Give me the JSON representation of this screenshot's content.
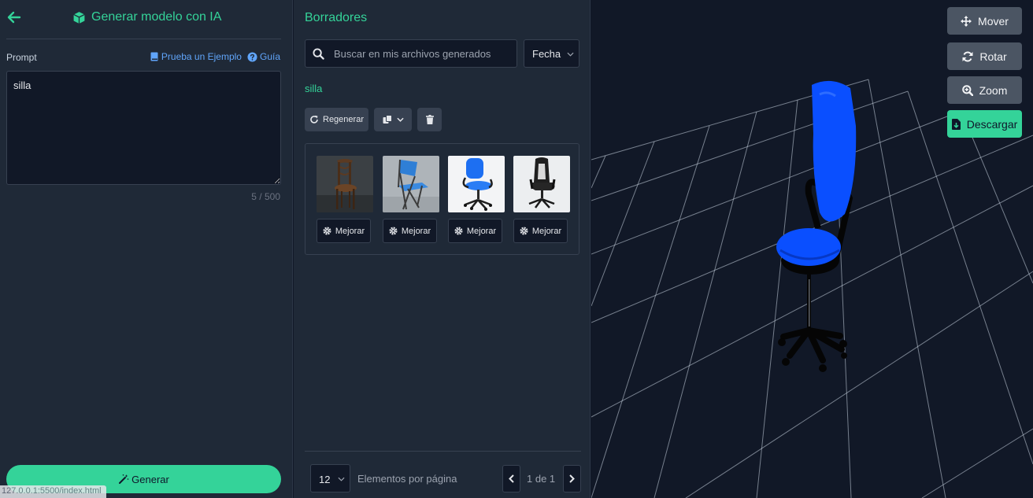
{
  "colors": {
    "accent": "#34d399",
    "link": "#60a5fa",
    "panel": "#1f2937",
    "background": "#111827",
    "model": "#0a4fff"
  },
  "left_panel": {
    "back_icon": "arrow-left-icon",
    "title_icon": "cube-icon",
    "title": "Generar modelo con IA",
    "prompt_label": "Prompt",
    "example_link": "Prueba un Ejemplo",
    "example_icon": "book-icon",
    "guide_link": "Guía",
    "guide_icon": "question-circle-icon",
    "prompt_value": "silla",
    "char_count": "5 / 500",
    "generate_label": "Generar",
    "generate_icon": "magic-wand-icon",
    "status_url": "127.0.0.1:5500/index.html"
  },
  "middle_panel": {
    "title": "Borradores",
    "search_placeholder": "Buscar en mis archivos generados",
    "sort_selected": "Fecha",
    "query": "silla",
    "regenerate_label": "Regenerar",
    "thumbnails": [
      {
        "subject": "wooden-chair",
        "button": "Mejorar"
      },
      {
        "subject": "folding-blue-chair",
        "button": "Mejorar"
      },
      {
        "subject": "blue-office-chair",
        "button": "Mejorar"
      },
      {
        "subject": "gaming-chair",
        "button": "Mejorar"
      }
    ],
    "per_page_value": "12",
    "per_page_label": "Elementos por página",
    "page_indicator": "1 de 1"
  },
  "viewer": {
    "move_label": "Mover",
    "move_icon": "arrows-move-icon",
    "rotate_label": "Rotar",
    "rotate_icon": "rotate-icon",
    "zoom_label": "Zoom",
    "zoom_icon": "zoom-in-icon",
    "download_label": "Descargar",
    "download_icon": "file-download-icon"
  }
}
